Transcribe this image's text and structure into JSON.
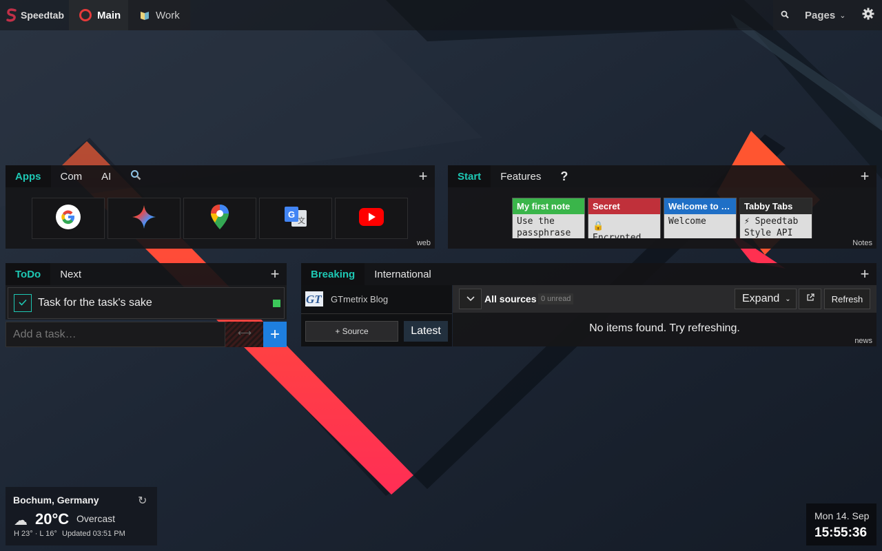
{
  "colors": {
    "accent": "#1ec8b4",
    "add_button": "#1e7fe0",
    "note_green": "#3ab54a",
    "note_red": "#c0303a",
    "note_blue": "#1f6fc6",
    "note_dark": "#2a2a2a",
    "todo_dot": "#3cc85a"
  },
  "topbar": {
    "brand": "Speedtab",
    "tabs": [
      {
        "label": "Main",
        "icon": "opera-icon"
      },
      {
        "label": "Work",
        "icon": "book-icon"
      }
    ],
    "pages_label": "Pages"
  },
  "apps_panel": {
    "tabs": [
      "Apps",
      "Com",
      "AI"
    ],
    "apps": [
      {
        "name": "Google",
        "icon": "google-icon"
      },
      {
        "name": "Gemini",
        "icon": "gemini-icon"
      },
      {
        "name": "Maps",
        "icon": "maps-icon"
      },
      {
        "name": "Translate",
        "icon": "translate-icon"
      },
      {
        "name": "YouTube",
        "icon": "youtube-icon"
      }
    ],
    "corner_label": "web"
  },
  "notes_panel": {
    "tabs": [
      "Start",
      "Features",
      "?"
    ],
    "notes": [
      {
        "title": "My first note",
        "body": "Use the\npassphrase",
        "color": "#3ab54a"
      },
      {
        "title": "Secret",
        "body": "🔒 Encrypted",
        "color": "#c0303a"
      },
      {
        "title": "Welcome to …",
        "body": "Welcome",
        "color": "#1f6fc6"
      },
      {
        "title": "Tabby Tabs",
        "body": "⚡ Speedtab\nStyle API",
        "color": "#2a2a2a"
      }
    ],
    "corner_label": "Notes"
  },
  "todo_panel": {
    "tabs": [
      "ToDo",
      "Next"
    ],
    "tasks": [
      {
        "text": "Task for the task's sake",
        "done": true
      }
    ],
    "input_placeholder": "Add a task…"
  },
  "news_panel": {
    "tabs": [
      "Breaking",
      "International"
    ],
    "source_name": "GTmetrix Blog",
    "add_source_label": "+ Source",
    "latest_label": "Latest",
    "all_sources_label": "All sources",
    "unread_label": "0 unread",
    "expand_label": "Expand",
    "refresh_label": "Refresh",
    "empty_message": "No items found. Try refreshing.",
    "corner_label": "news"
  },
  "weather": {
    "location": "Bochum, Germany",
    "temperature": "20°C",
    "condition": "Overcast",
    "high_low": "H 23° · L 16°",
    "updated": "Updated 03:51 PM"
  },
  "clock": {
    "date": "Mon 14. Sep",
    "time": "15:55:36"
  }
}
